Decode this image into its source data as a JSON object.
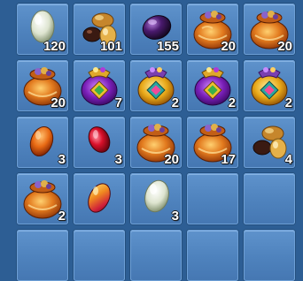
{
  "inventory": {
    "slots": [
      {
        "item": "white-stone",
        "count": "120"
      },
      {
        "item": "mixed-gems",
        "count": "101"
      },
      {
        "item": "purple-stone",
        "count": "155"
      },
      {
        "item": "orange-sack",
        "count": "20"
      },
      {
        "item": "orange-sack",
        "count": "20"
      },
      {
        "item": "orange-sack",
        "count": "20"
      },
      {
        "item": "purple-pouch",
        "count": "7"
      },
      {
        "item": "gold-pouch",
        "count": "2"
      },
      {
        "item": "purple-pouch",
        "count": "2"
      },
      {
        "item": "gold-pouch",
        "count": "2"
      },
      {
        "item": "orange-stone",
        "count": "3"
      },
      {
        "item": "red-stone",
        "count": "3"
      },
      {
        "item": "orange-sack",
        "count": "20"
      },
      {
        "item": "orange-sack",
        "count": "17"
      },
      {
        "item": "mixed-gems",
        "count": "4"
      },
      {
        "item": "orange-sack",
        "count": "2"
      },
      {
        "item": "fire-stone",
        "count": ""
      },
      {
        "item": "white-stone",
        "count": "3"
      },
      {
        "item": "",
        "count": ""
      },
      {
        "item": "",
        "count": ""
      }
    ]
  }
}
